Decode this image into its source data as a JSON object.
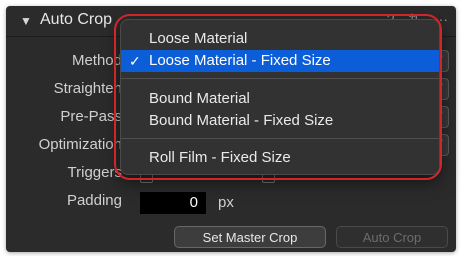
{
  "header": {
    "title": "Auto Crop",
    "chevron_icon": "chevron-down-icon",
    "icons": [
      "?",
      "⇅",
      "···"
    ]
  },
  "labels": {
    "method": "Method",
    "straighten": "Straighten",
    "prepass": "Pre-Pass",
    "optimization": "Optimization",
    "triggers": "Triggers",
    "padding": "Padding"
  },
  "padding": {
    "value": "0",
    "unit": "px"
  },
  "buttons": {
    "set_master": "Set Master Crop",
    "auto_crop": "Auto Crop"
  },
  "menu": {
    "items": [
      {
        "label": "Loose Material",
        "selected": false
      },
      {
        "label": "Loose Material - Fixed Size",
        "selected": true
      },
      {
        "label": "Bound Material",
        "selected": false
      },
      {
        "label": "Bound Material - Fixed Size",
        "selected": false
      },
      {
        "label": "Roll Film - Fixed Size",
        "selected": false
      }
    ],
    "checkmark": "✓"
  },
  "colors": {
    "highlight": "#0b5ed7",
    "ring": "#d0262a",
    "panel": "#2b2b2b"
  }
}
